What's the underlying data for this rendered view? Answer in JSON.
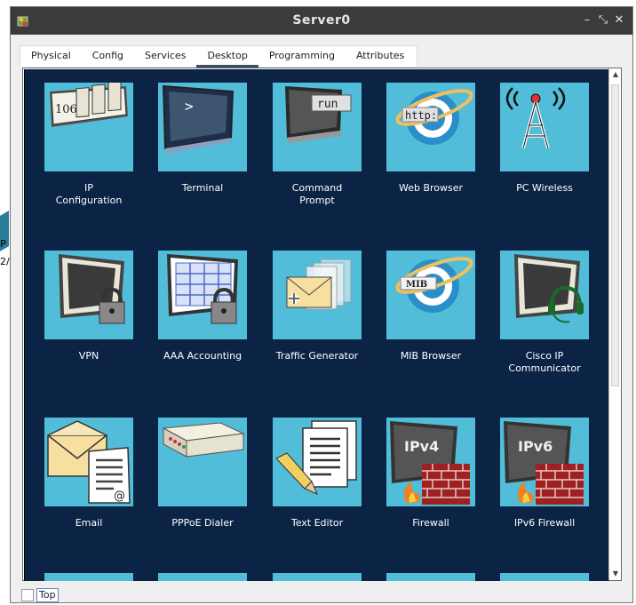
{
  "window": {
    "title": "Server0"
  },
  "titlebar_controls": [
    "–",
    "⤡",
    "✕"
  ],
  "tabs": [
    {
      "label": "Physical",
      "active": false
    },
    {
      "label": "Config",
      "active": false
    },
    {
      "label": "Services",
      "active": false
    },
    {
      "label": "Desktop",
      "active": true
    },
    {
      "label": "Programming",
      "active": false
    },
    {
      "label": "Attributes",
      "active": false
    }
  ],
  "apps": [
    {
      "label": "IP\nConfiguration",
      "icon": "ip-config-icon",
      "badge": "106"
    },
    {
      "label": "Terminal",
      "icon": "terminal-icon",
      "badge": ">"
    },
    {
      "label": "Command\nPrompt",
      "icon": "command-prompt-icon",
      "badge": "run"
    },
    {
      "label": "Web Browser",
      "icon": "web-browser-icon",
      "badge": "http:"
    },
    {
      "label": "PC Wireless",
      "icon": "pc-wireless-icon"
    },
    {
      "label": "VPN",
      "icon": "vpn-icon"
    },
    {
      "label": "AAA Accounting",
      "icon": "aaa-accounting-icon"
    },
    {
      "label": "Traffic Generator",
      "icon": "traffic-generator-icon"
    },
    {
      "label": "MIB Browser",
      "icon": "mib-browser-icon",
      "badge": "MIB"
    },
    {
      "label": "Cisco IP\nCommunicator",
      "icon": "cisco-ip-communicator-icon"
    },
    {
      "label": "Email",
      "icon": "email-icon",
      "badge": "@"
    },
    {
      "label": "PPPoE Dialer",
      "icon": "pppoe-dialer-icon"
    },
    {
      "label": "Text Editor",
      "icon": "text-editor-icon"
    },
    {
      "label": "Firewall",
      "icon": "firewall-icon",
      "badge": "IPv4"
    },
    {
      "label": "IPv6 Firewall",
      "icon": "ipv6-firewall-icon",
      "badge": "IPv6"
    }
  ],
  "bottom": {
    "top_label": "Top",
    "checkbox_checked": false
  },
  "colors": {
    "titlebar": "#3b3b3b",
    "desktop_bg": "#0b2345",
    "tile_bg": "#52bdd8"
  }
}
